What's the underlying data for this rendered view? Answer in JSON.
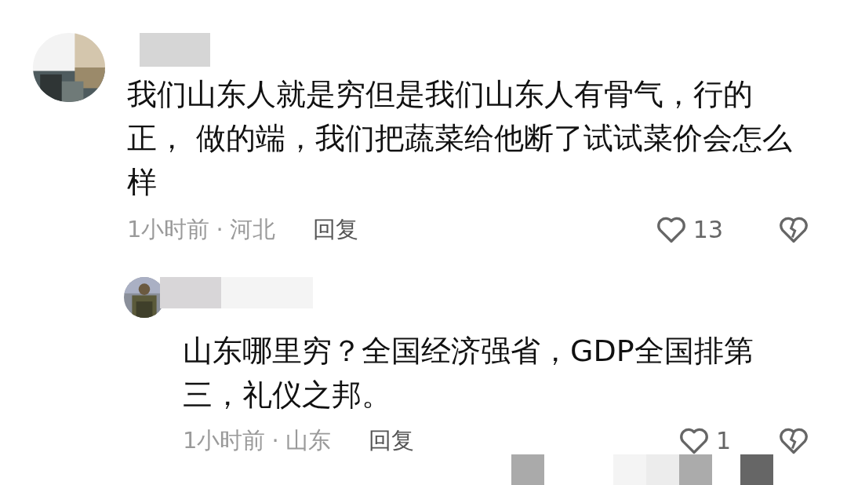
{
  "comments": [
    {
      "name_hidden": true,
      "text": "我们山东人就是穷但是我们山东人有骨气，行的正， 做的端，我们把蔬菜给他断了试试菜价会怎么样",
      "time": "1小时前",
      "separator": "·",
      "location": "河北",
      "reply_label": "回复",
      "likes": "13",
      "actions_obscured": false,
      "replies": [
        {
          "name_hidden": true,
          "text": "山东哪里穷？全国经济强省，GDP全国排第三，礼仪之邦。",
          "time": "1小时前",
          "separator": "·",
          "location": "山东",
          "reply_label": "回复",
          "likes": "1",
          "actions_obscured": true
        }
      ]
    }
  ]
}
